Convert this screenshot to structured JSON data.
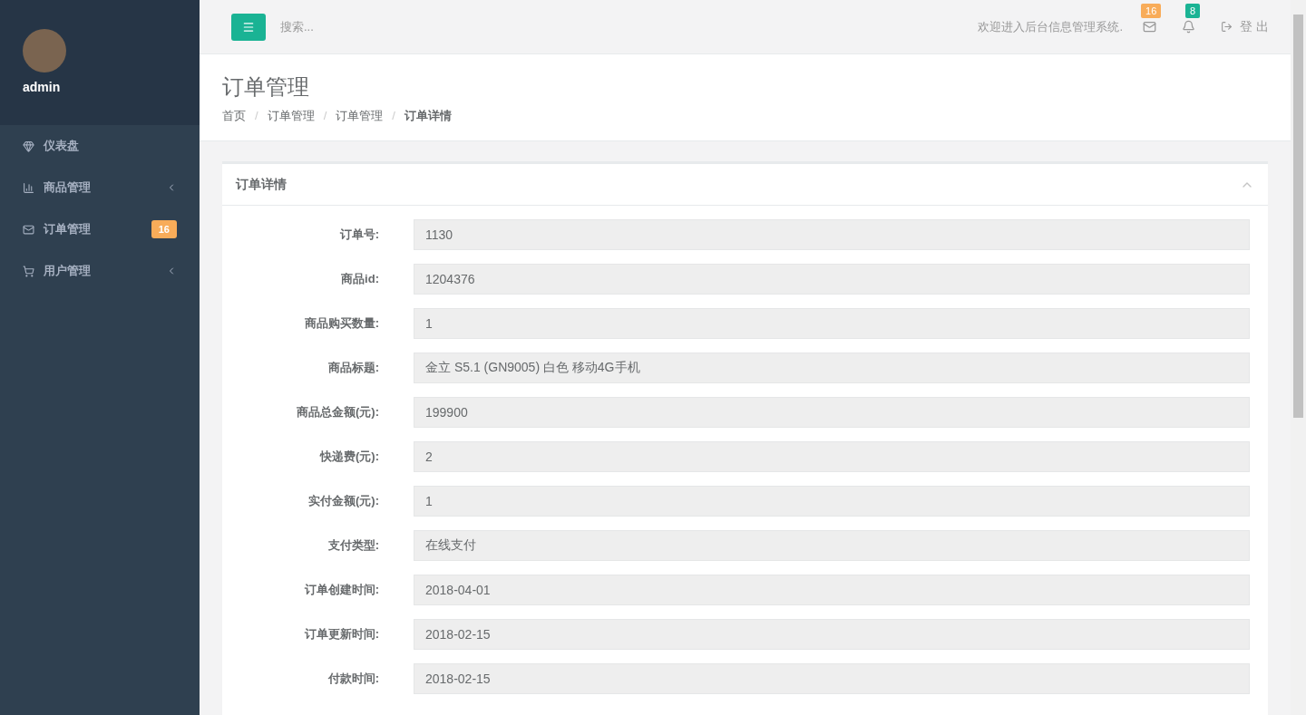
{
  "user": {
    "name": "admin"
  },
  "sidebar": {
    "items": [
      {
        "label": "仪表盘",
        "expandable": false
      },
      {
        "label": "商品管理",
        "expandable": true
      },
      {
        "label": "订单管理",
        "expandable": false,
        "badge": "16"
      },
      {
        "label": "用户管理",
        "expandable": true
      }
    ]
  },
  "topbar": {
    "search": {
      "placeholder": "搜索..."
    },
    "welcome": "欢迎进入后台信息管理系统.",
    "mail_count": "16",
    "alert_count": "8",
    "logout": "登 出"
  },
  "page": {
    "title": "订单管理",
    "breadcrumb": [
      "首页",
      "订单管理",
      "订单管理",
      "订单详情"
    ],
    "breadcrumb_separator": "/"
  },
  "panel": {
    "title": "订单详情",
    "expanded": true,
    "fields": [
      {
        "label": "订单号:",
        "value": "1130"
      },
      {
        "label": "商品id:",
        "value": "1204376"
      },
      {
        "label": "商品购买数量:",
        "value": "1"
      },
      {
        "label": "商品标题:",
        "value": "金立 S5.1 (GN9005) 白色 移动4G手机"
      },
      {
        "label": "商品总金额(元):",
        "value": "199900"
      },
      {
        "label": "快递费(元):",
        "value": "2"
      },
      {
        "label": "实付金额(元):",
        "value": "1"
      },
      {
        "label": "支付类型:",
        "value": "在线支付"
      },
      {
        "label": "订单创建时间:",
        "value": "2018-04-01"
      },
      {
        "label": "订单更新时间:",
        "value": "2018-02-15"
      },
      {
        "label": "付款时间:",
        "value": "2018-02-15"
      }
    ]
  }
}
